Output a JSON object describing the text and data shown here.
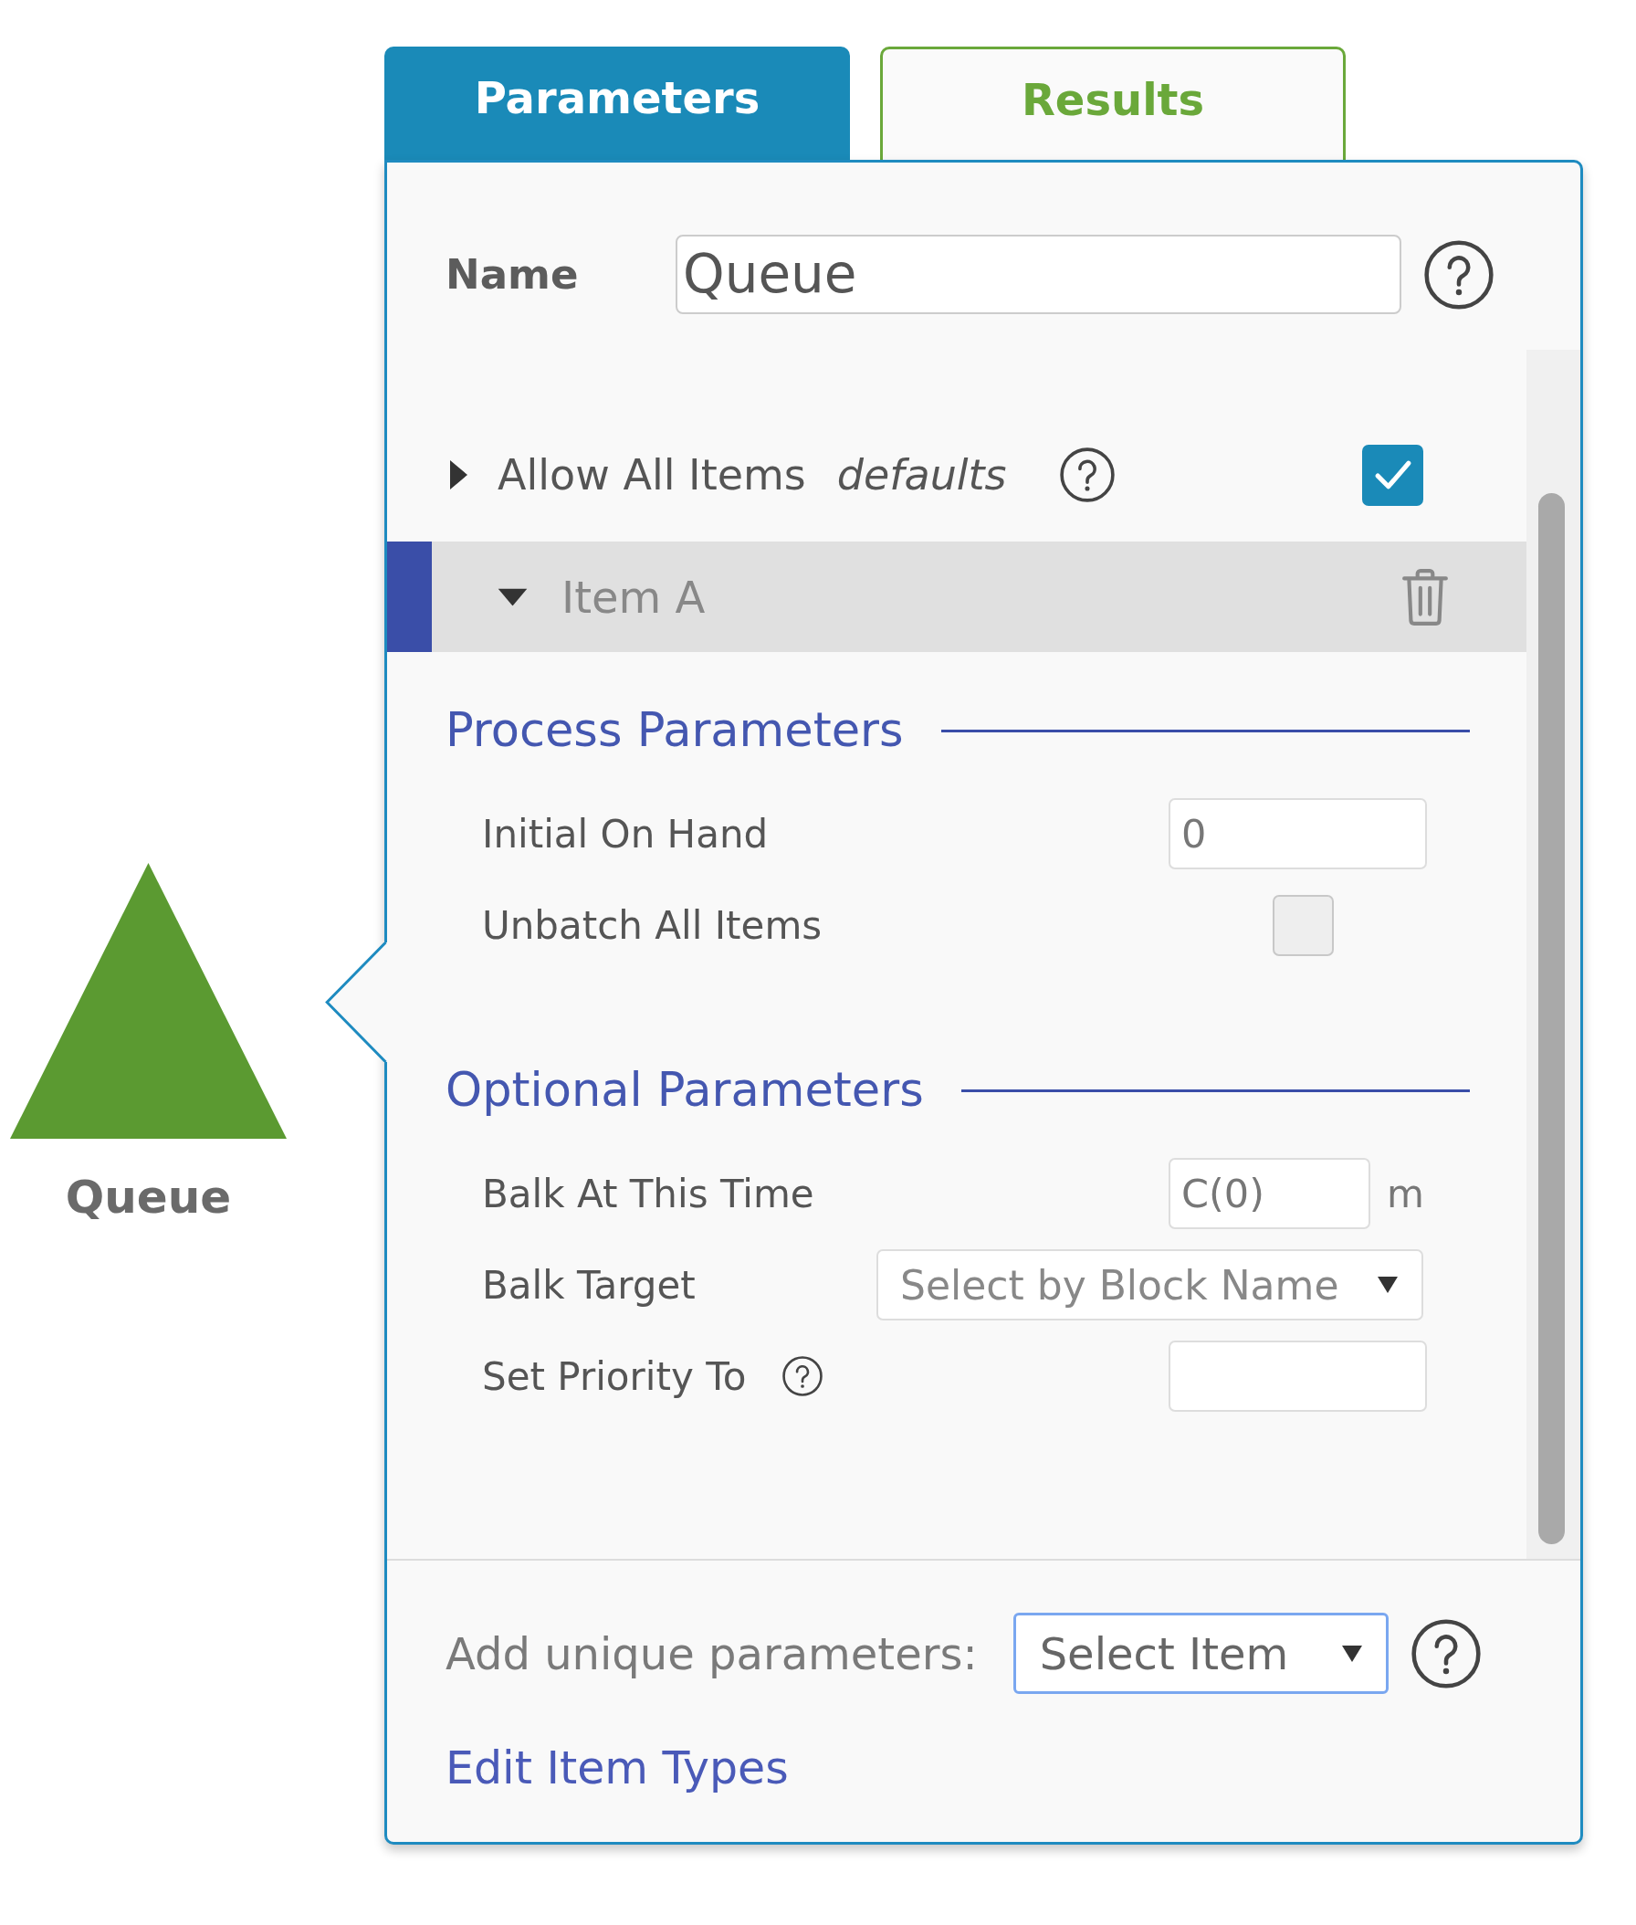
{
  "node": {
    "label": "Queue"
  },
  "tabs": [
    {
      "label": "Parameters",
      "selected": true
    },
    {
      "label": "Results",
      "selected": false
    }
  ],
  "name_field": {
    "label": "Name",
    "value": "Queue"
  },
  "allow_all_items": {
    "label": "Allow All Items",
    "note": "defaults",
    "expanded": false,
    "checked": true
  },
  "items": [
    {
      "name": "Item A",
      "expanded": true,
      "sections": [
        {
          "title": "Process Parameters",
          "fields": [
            {
              "kind": "input",
              "label": "Initial On Hand",
              "help": false,
              "value": "0"
            },
            {
              "kind": "checkbox",
              "label": "Unbatch All Items",
              "help": false,
              "checked": false
            }
          ]
        },
        {
          "title": "Optional Parameters",
          "fields": [
            {
              "kind": "input",
              "label": "Balk At This Time",
              "help": false,
              "value": "C(0)",
              "unit": "m"
            },
            {
              "kind": "select",
              "label": "Balk Target",
              "help": false,
              "value": "Select by Block Name"
            },
            {
              "kind": "input",
              "label": "Set Priority To",
              "help": true
            }
          ]
        }
      ]
    }
  ],
  "footer": {
    "label": "Add unique parameters:",
    "select": {
      "value": "Select Item",
      "focused": true
    },
    "link": "Edit Item Types"
  }
}
